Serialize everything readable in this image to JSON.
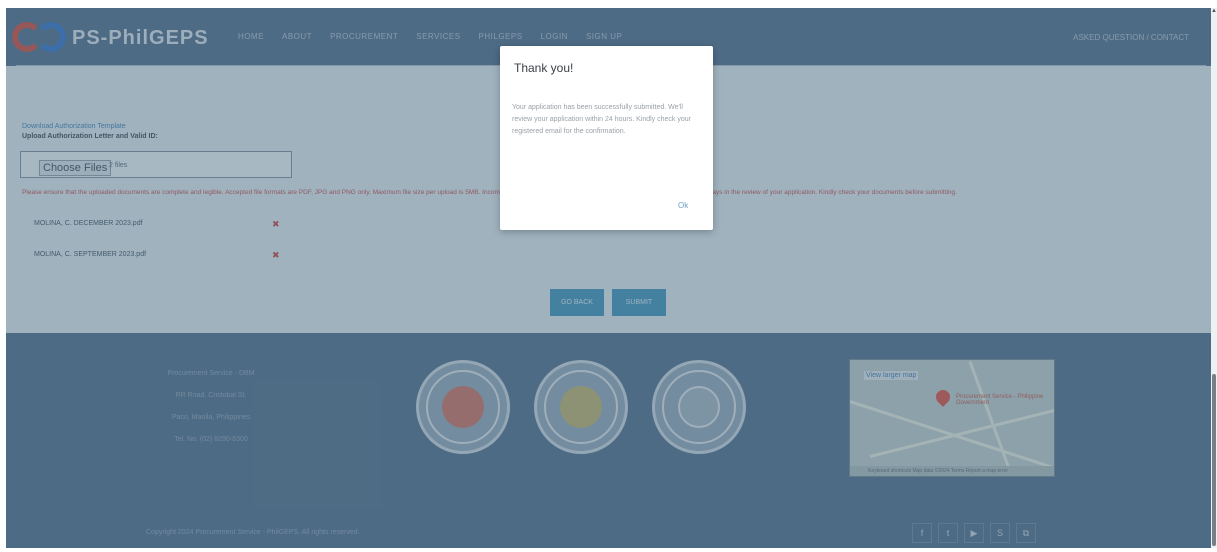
{
  "navbar": {
    "brand": "PS-PhilGEPS",
    "links": [
      "HOME",
      "ABOUT",
      "PROCUREMENT",
      "SERVICES",
      "PHILGEPS",
      "LOGIN",
      "SIGN UP"
    ],
    "right": "ASKED QUESTION / CONTACT"
  },
  "upload": {
    "download_link": "Download Authorization Template",
    "label": "Upload Authorization Letter and Valid ID:",
    "choose_button": "Choose Files",
    "file_count": "2 files",
    "warning": "Please ensure that the uploaded documents are complete and legible. Accepted file formats are PDF, JPG and PNG only. Maximum file size per upload is 5MB. Incomplete or unreadable submissions will not be processed and may cause delays in the review of your application. Kindly check your documents before submitting.",
    "files": [
      {
        "name": "MOLINA, C. DECEMBER 2023.pdf"
      },
      {
        "name": "MOLINA, C. SEPTEMBER 2023.pdf"
      }
    ],
    "back_button": "GO BACK",
    "submit_button": "SUBMIT"
  },
  "footer": {
    "info": [
      "Procurement Service - DBM",
      "RR Road, Cristobal St.",
      "Paco, Manila, Philippines",
      "Tel. No. (02) 8290-6300"
    ],
    "map": {
      "label": "View larger map",
      "place": "Procurement Service - Philippine Government",
      "footer": "Keyboard shortcuts   Map data ©2024   Terms   Report a map error"
    },
    "copyright": "Copyright 2024 Procurement Service - PhilGEPS. All rights reserved.",
    "social": [
      "f",
      "t",
      "▶",
      "S",
      "⧉"
    ]
  },
  "modal": {
    "title": "Thank you!",
    "body": "Your application has been successfully submitted. We'll review your application within 24 hours. Kindly check your registered email for the confirmation.",
    "ok": "Ok"
  },
  "colors": {
    "navbar": "#4f6a89",
    "accent": "#3d8fb7",
    "warning": "#c24b4b"
  }
}
